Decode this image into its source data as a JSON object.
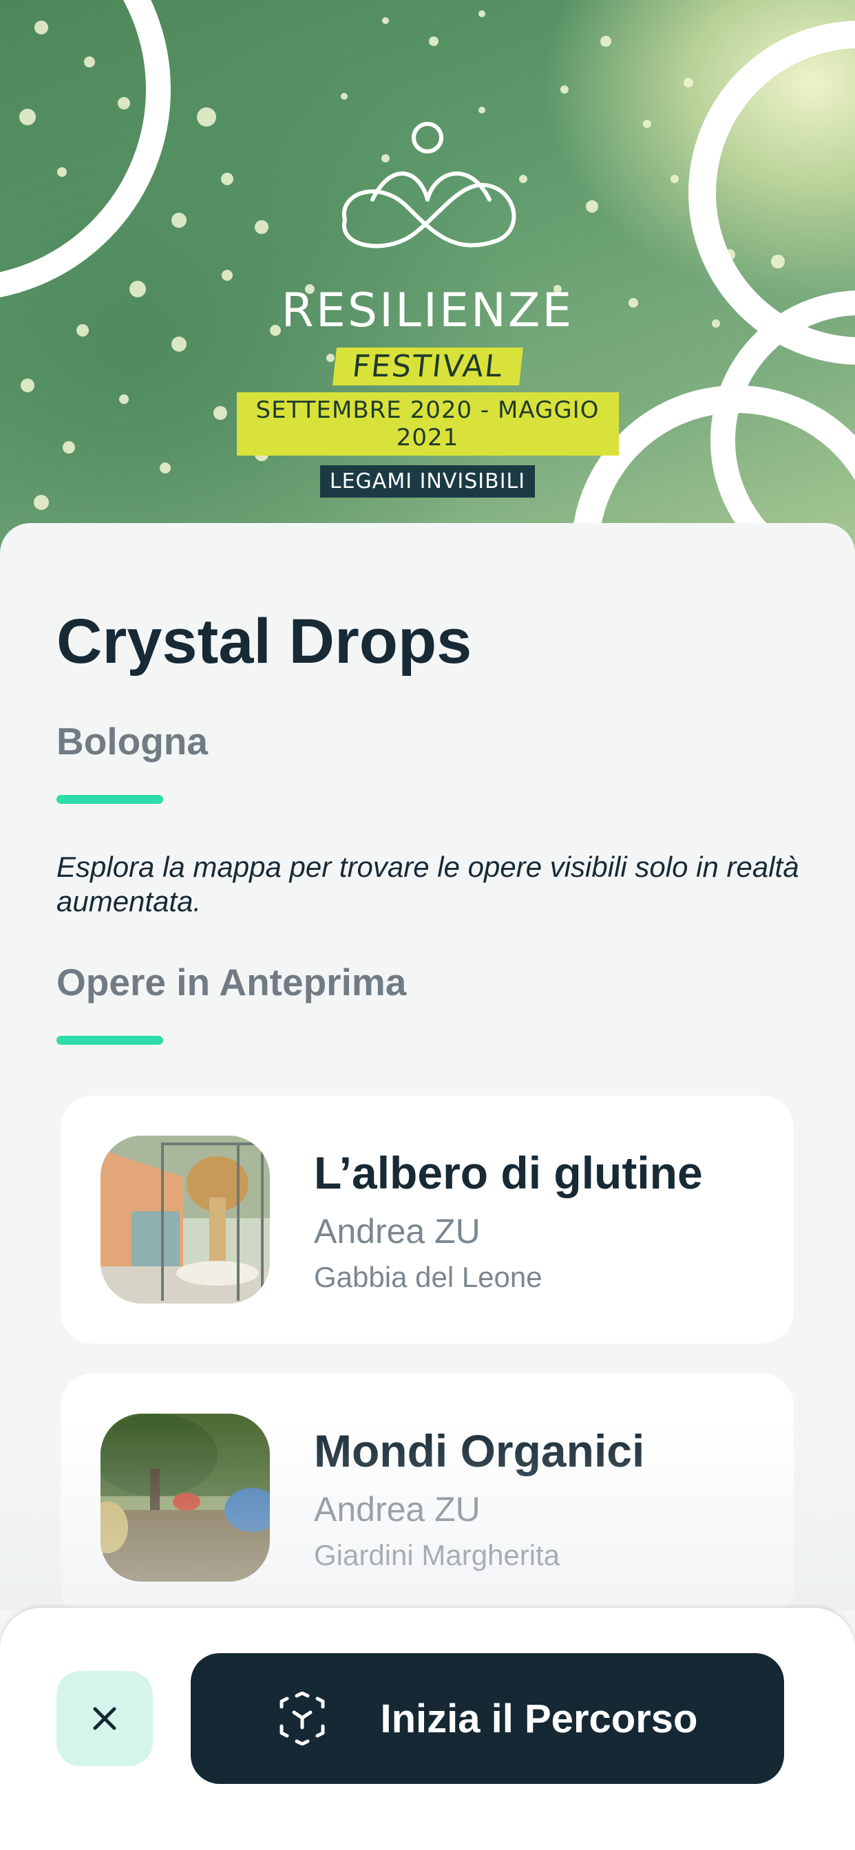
{
  "hero": {
    "logo_title": "RESILIENZE",
    "logo_tag": "FESTIVAL",
    "logo_dates": "SETTEMBRE 2020 - MAGGIO 2021",
    "logo_sub": "LEGAMI INVISIBILI"
  },
  "main": {
    "title": "Crystal Drops",
    "city": "Bologna",
    "description": "Esplora la mappa per trovare le opere visibili solo in realtà aumentata.",
    "section_title": "Opere in Anteprima"
  },
  "works": [
    {
      "title": "L’albero di glutine",
      "artist": "Andrea ZU",
      "place": "Gabbia del Leone"
    },
    {
      "title": "Mondi Organici",
      "artist": "Andrea ZU",
      "place": "Giardini Margherita"
    }
  ],
  "actions": {
    "close_icon": "close-icon",
    "start_icon": "ar-cube-icon",
    "start_label": "Inizia il Percorso"
  },
  "colors": {
    "accent": "#2ddca8",
    "dark": "#152834",
    "close_bg": "#d5f5ea",
    "festival_yellow": "#d9e23a"
  }
}
